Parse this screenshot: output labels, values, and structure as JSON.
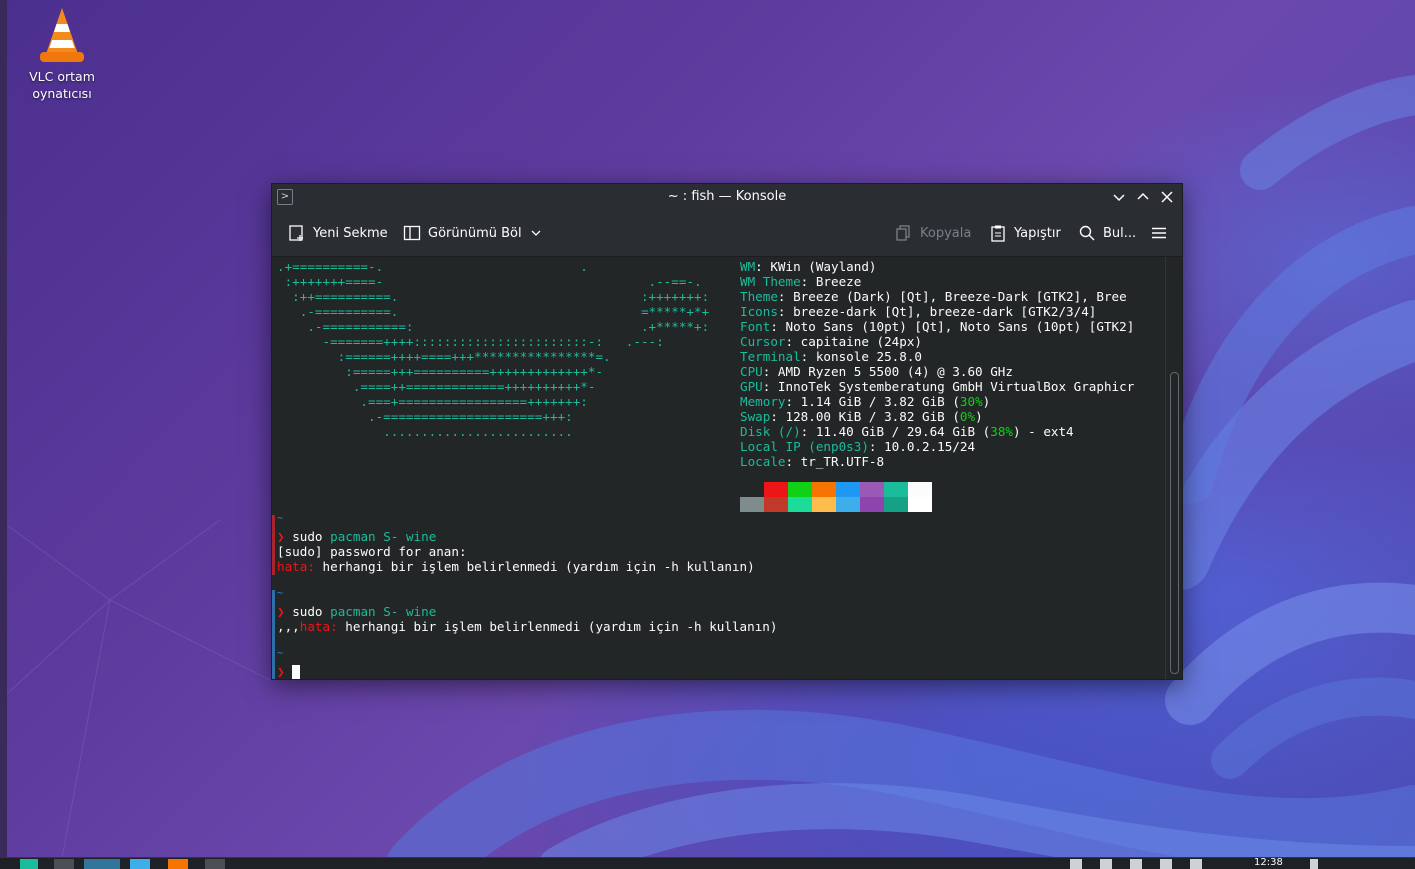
{
  "desktop": {
    "icons": [
      {
        "label_line1": "VLC ortam",
        "label_line2": "oynatıcısı",
        "icon": "vlc-cone-icon"
      }
    ]
  },
  "window": {
    "title": "~ : fish — Konsole",
    "toolbar": {
      "new_tab": "Yeni Sekme",
      "split_view": "Görünümü Böl",
      "copy": "Kopyala",
      "paste": "Yapıştır",
      "find": "Bul..."
    }
  },
  "terminal": {
    "art": [
      ".+==========-.                          .",
      " :+++++++====-                                   .--==-.",
      "  :++==========.                                :+++++++:",
      "   .-==========.                                =*****+*+",
      "    .-===========:                              .+*****+:",
      "      -=======++++:::::::::::::::::::::::-:   .---:",
      "        :======++++====+++****************=.",
      "         :=====+++==========+++++++++++++*-",
      "          .====++=============++++++++++*-",
      "           .===+=================+++++++:",
      "            .-=====================+++:",
      "              ........................."
    ],
    "sysinfo": [
      {
        "key": "WM",
        "value": "KWin (Wayland)"
      },
      {
        "key": "WM Theme",
        "value": "Breeze"
      },
      {
        "key": "Theme",
        "value": "Breeze (Dark) [Qt], Breeze-Dark [GTK2], Bree"
      },
      {
        "key": "Icons",
        "value": "breeze-dark [Qt], breeze-dark [GTK2/3/4]"
      },
      {
        "key": "Font",
        "value": "Noto Sans (10pt) [Qt], Noto Sans (10pt) [GTK2]"
      },
      {
        "key": "Cursor",
        "value": "capitaine (24px)"
      },
      {
        "key": "Terminal",
        "value": "konsole 25.8.0"
      },
      {
        "key": "CPU",
        "value": "AMD Ryzen 5 5500 (4) @ 3.60 GHz"
      },
      {
        "key": "GPU",
        "value": "InnoTek Systemberatung GmbH VirtualBox Graphicr"
      },
      {
        "key": "Memory",
        "pre": "1.14 GiB / 3.82 GiB (",
        "pct": "30%",
        "post": ")"
      },
      {
        "key": "Swap",
        "pre": "128.00 KiB / 3.82 GiB (",
        "pct": "0%",
        "post": ")"
      },
      {
        "key": "Disk (/)",
        "pre": "11.40 GiB / 29.64 GiB (",
        "pct": "38%",
        "post": ") - ext4"
      },
      {
        "key": "Local IP (enp0s3)",
        "value": "10.0.2.15/24"
      },
      {
        "key": "Locale",
        "value": "tr_TR.UTF-8"
      }
    ],
    "palette_top": [
      "#232627",
      "#ed1515",
      "#11d116",
      "#f67400",
      "#1d99f3",
      "#9b59b6",
      "#1abc9c",
      "#fcfcfc"
    ],
    "palette_bottom": [
      "#7f8c8d",
      "#c0392b",
      "#1cdc9a",
      "#fdbc4b",
      "#3daee9",
      "#8e44ad",
      "#16a085",
      "#ffffff"
    ],
    "session": {
      "prompt_dir": "~",
      "prompt_sym": "❯",
      "cmd1_a": "sudo",
      "cmd1_b": "pacman S- wine",
      "password_line": "[sudo] password for anan:",
      "err_label": "hata:",
      "err_text": "herhangi bir işlem belirlenmedi (yardım için -h kullanın)",
      "cmd2_a": "sudo",
      "cmd2_b": "pacman S- wine",
      "err2_prefix": ",,,",
      "err2_label": "hata:",
      "err2_text": "herhangi bir işlem belirlenmedi (yardım için -h kullanın)"
    }
  },
  "taskbar": {
    "clock": "12:38"
  }
}
